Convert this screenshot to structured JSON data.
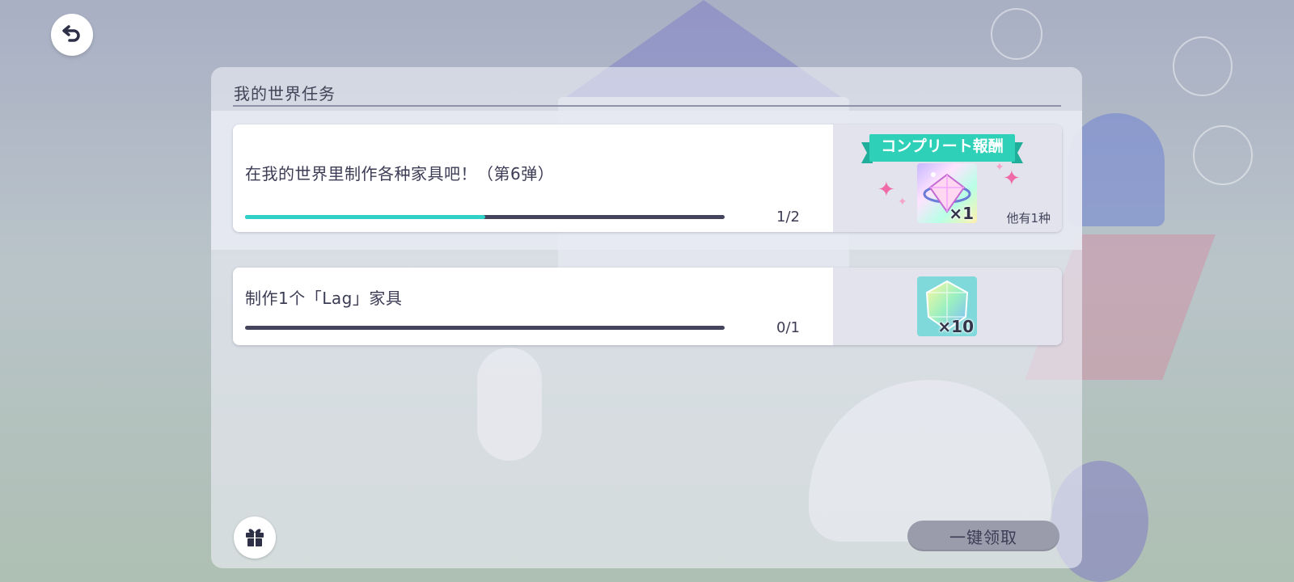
{
  "panel": {
    "title": "我的世界任务"
  },
  "missions": [
    {
      "text": "在我的世界里制作各种家具吧！（第6弹）",
      "progress_text": "1/2",
      "progress_fraction": 0.5,
      "ribbon": "コンプリート報酬",
      "reward_qty": "×1",
      "reward_more": "他有1种"
    },
    {
      "text": "制作1个「Lag」家具",
      "progress_text": "0/1",
      "progress_fraction": 0,
      "reward_qty": "×10"
    }
  ],
  "footer": {
    "claim_all_label": "一键领取"
  },
  "icons": {
    "back": "back-arrow-icon",
    "gift": "gift-icon",
    "reward1": "rainbow-crystal-icon",
    "reward2": "gem-icon"
  },
  "colors": {
    "progress_fill": "#2fd0c6",
    "progress_track": "#44455c",
    "ribbon": "#2fd0b8",
    "claim_button": "#9a9cac"
  }
}
